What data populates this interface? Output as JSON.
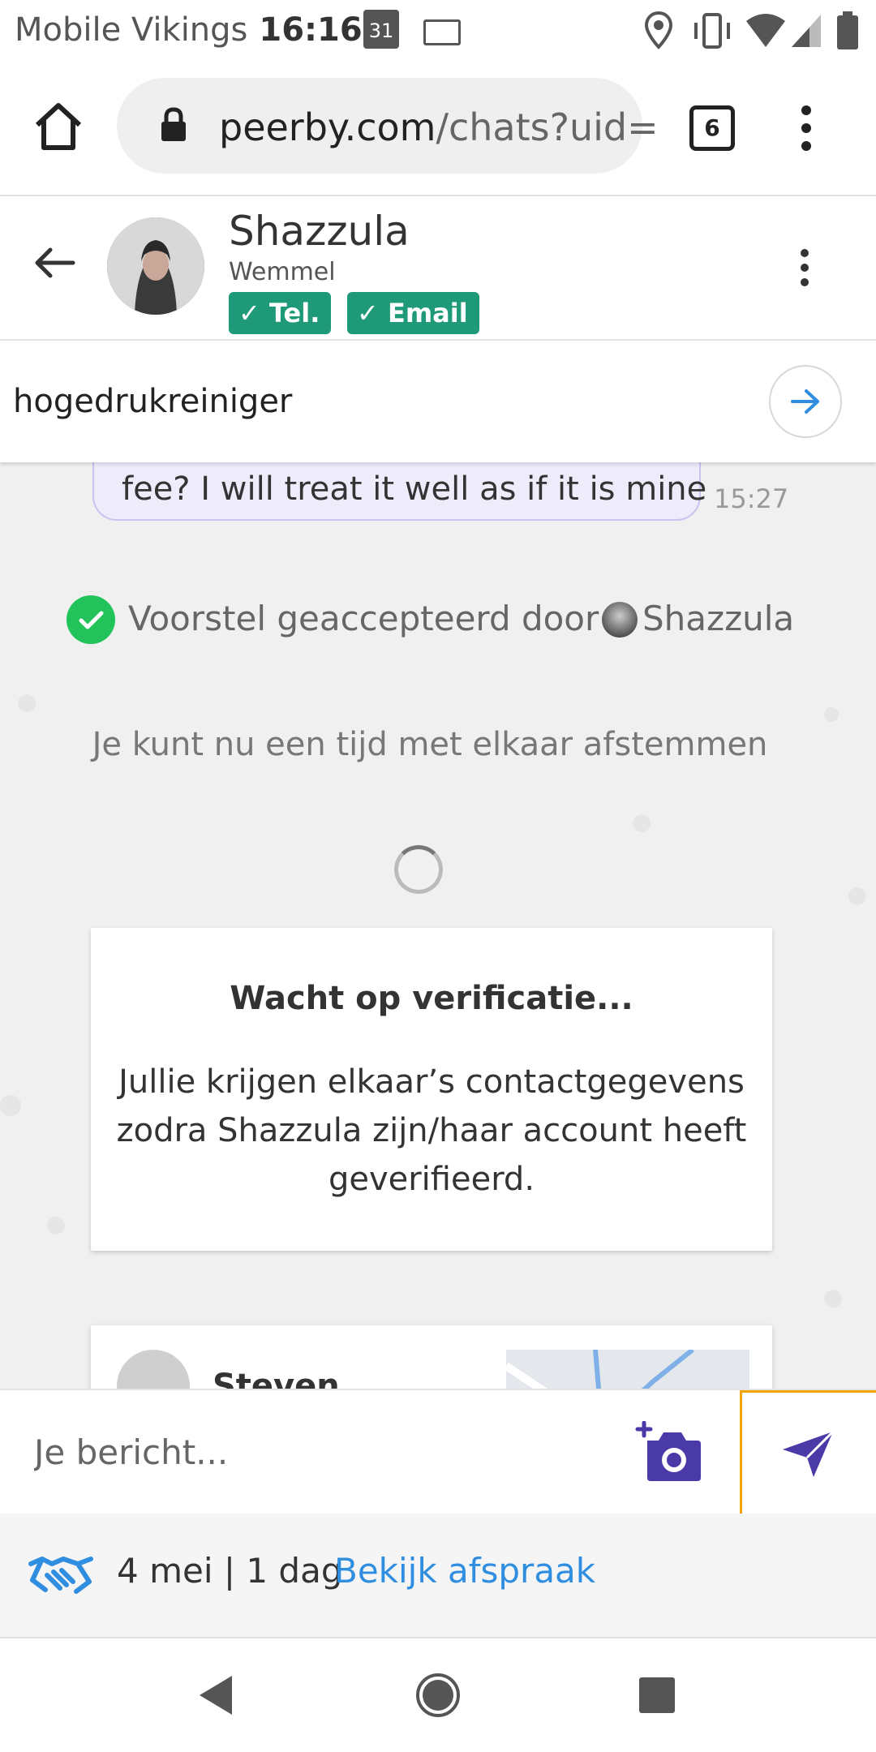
{
  "status_bar": {
    "carrier": "Mobile Vikings",
    "time": "16:16",
    "calendar_day": "31"
  },
  "browser": {
    "url_host": "peerby.com",
    "url_path": "/chats?uid=",
    "tab_count": "6"
  },
  "chat_header": {
    "name": "Shazzula",
    "location": "Wemmel",
    "badges": [
      {
        "label": "Tel."
      },
      {
        "label": "Email"
      }
    ],
    "badge_color": "#1e9a78"
  },
  "subject": {
    "text": "hogedrukreiniger"
  },
  "messages": {
    "last_text": "fee? I will treat it well as if it is mine",
    "last_time": "15:27"
  },
  "accepted": {
    "text": "Voorstel geaccepteerd door",
    "name": "Shazzula"
  },
  "schedule_info": {
    "text": "Je kunt nu een tijd met elkaar afstemmen"
  },
  "verification": {
    "title": "Wacht op verificatie...",
    "body": "Jullie krijgen elkaar’s contactgegevens zodra Shazzula zijn/haar account heeft geverifieerd."
  },
  "next_card": {
    "name": "Steven"
  },
  "input": {
    "placeholder": "Je bericht..."
  },
  "agreement": {
    "date": "4 mei | 1 dag",
    "link": "Bekijk afspraak"
  },
  "colors": {
    "accent_purple": "#4a3aa8",
    "link_blue": "#2f8ee0",
    "success_green": "#22c35a",
    "send_border": "#f0a500"
  }
}
